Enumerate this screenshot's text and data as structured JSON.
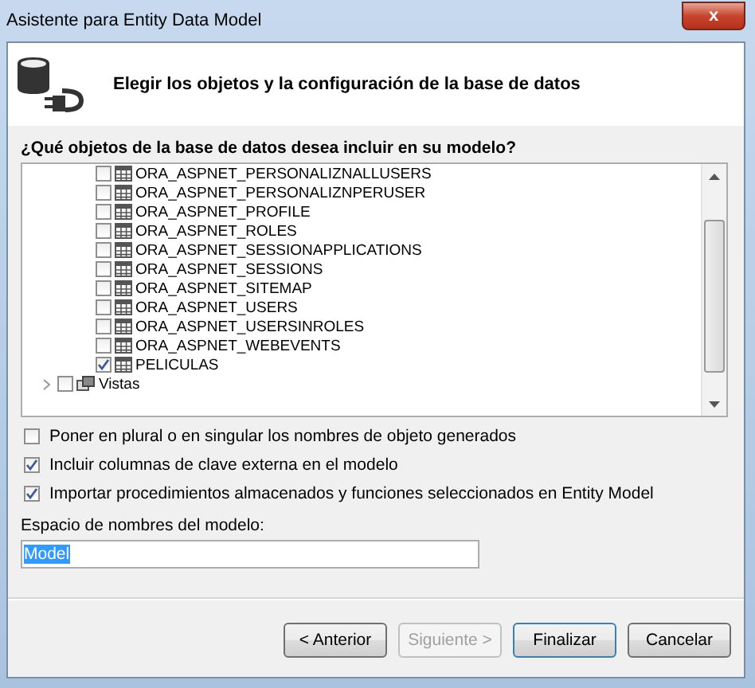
{
  "window": {
    "title": "Asistente para Entity Data Model",
    "close": "x"
  },
  "header": {
    "title": "Elegir los objetos y la configuración de la base de datos"
  },
  "tree": {
    "label": "¿Qué objetos de la base de datos desea incluir en su modelo?",
    "items": [
      {
        "kind": "table",
        "label": "ORA_ASPNET_PERSONALIZNALLUSERS",
        "checked": false
      },
      {
        "kind": "table",
        "label": "ORA_ASPNET_PERSONALIZNPERUSER",
        "checked": false
      },
      {
        "kind": "table",
        "label": "ORA_ASPNET_PROFILE",
        "checked": false
      },
      {
        "kind": "table",
        "label": "ORA_ASPNET_ROLES",
        "checked": false
      },
      {
        "kind": "table",
        "label": "ORA_ASPNET_SESSIONAPPLICATIONS",
        "checked": false
      },
      {
        "kind": "table",
        "label": "ORA_ASPNET_SESSIONS",
        "checked": false
      },
      {
        "kind": "table",
        "label": "ORA_ASPNET_SITEMAP",
        "checked": false
      },
      {
        "kind": "table",
        "label": "ORA_ASPNET_USERS",
        "checked": false
      },
      {
        "kind": "table",
        "label": "ORA_ASPNET_USERSINROLES",
        "checked": false
      },
      {
        "kind": "table",
        "label": "ORA_ASPNET_WEBEVENTS",
        "checked": false
      },
      {
        "kind": "table",
        "label": "PELICULAS",
        "checked": true
      },
      {
        "kind": "folder",
        "label": "Vistas",
        "checked": false,
        "expanded": false
      }
    ]
  },
  "options": [
    {
      "label": "Poner en plural o en singular los nombres de objeto generados",
      "checked": false
    },
    {
      "label": "Incluir columnas de clave externa en el modelo",
      "checked": true
    },
    {
      "label": "Importar procedimientos almacenados y funciones seleccionados en Entity Model",
      "checked": true
    }
  ],
  "namespace": {
    "label": "Espacio de nombres del modelo:",
    "value": "Model"
  },
  "buttons": [
    {
      "label": "< Anterior",
      "disabled": false,
      "default": false
    },
    {
      "label": "Siguiente >",
      "disabled": true,
      "default": false
    },
    {
      "label": "Finalizar",
      "disabled": false,
      "default": true
    },
    {
      "label": "Cancelar",
      "disabled": false,
      "default": false
    }
  ]
}
